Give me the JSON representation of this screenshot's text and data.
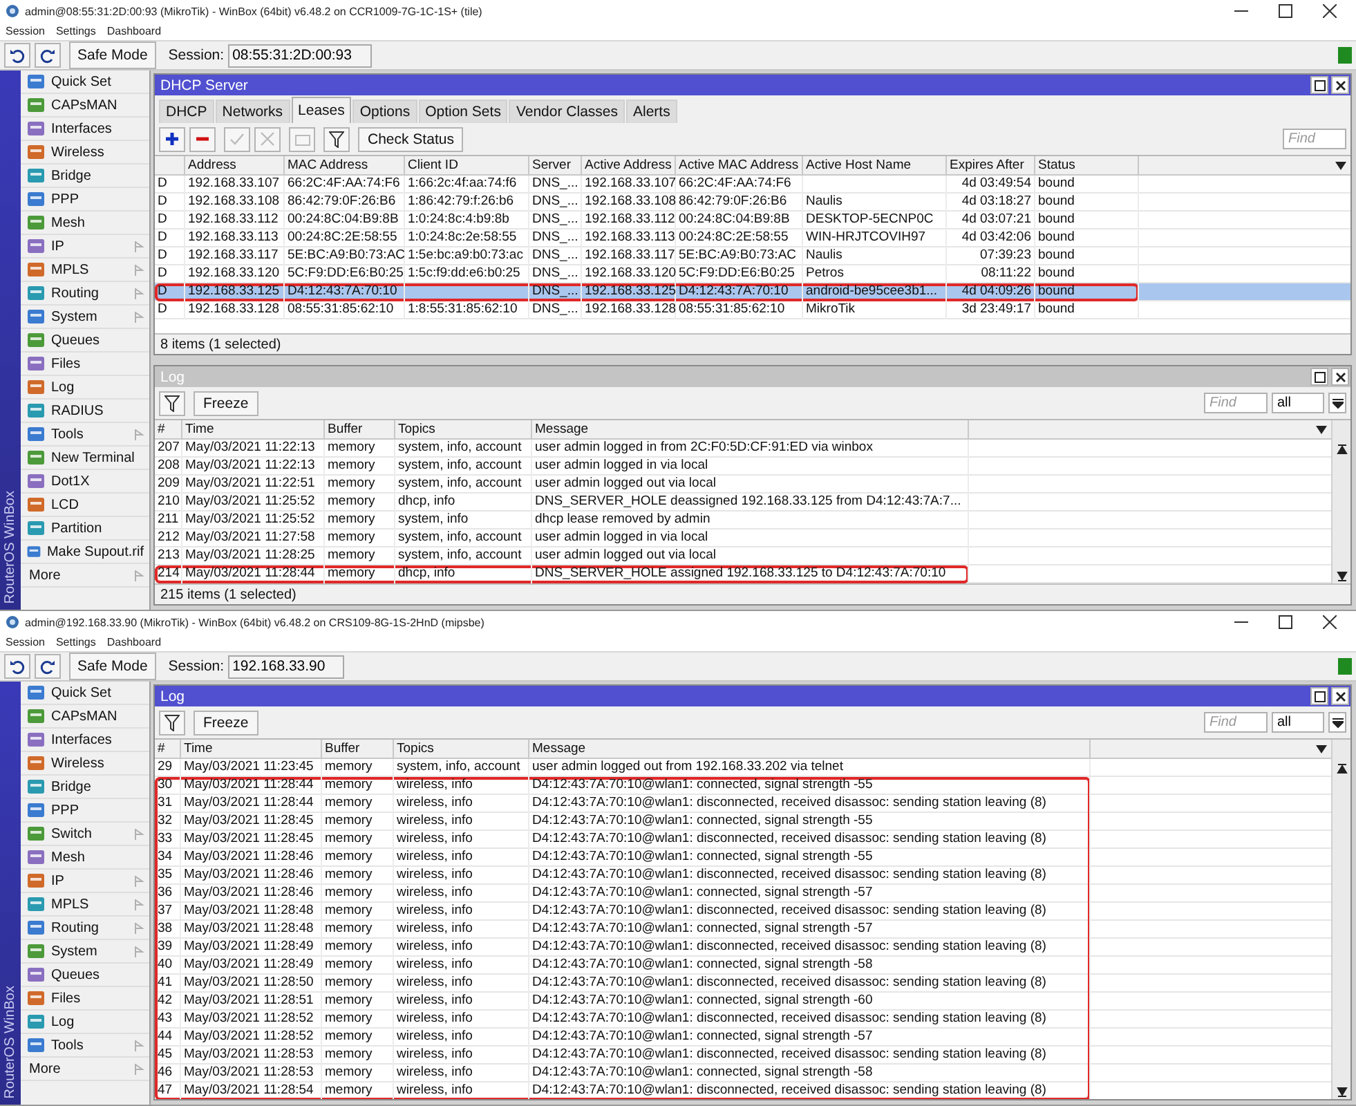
{
  "windows": [
    {
      "title": "admin@08:55:31:2D:00:93 (MikroTik) - WinBox (64bit) v6.48.2 on CCR1009-7G-1C-1S+ (tile)",
      "menu": [
        "Session",
        "Settings",
        "Dashboard"
      ],
      "safe_mode": "Safe Mode",
      "session_label": "Session:",
      "session_value": "08:55:31:2D:00:93",
      "brand": "RouterOS WinBox",
      "sidebar": [
        {
          "label": "Quick Set",
          "submenu": false
        },
        {
          "label": "CAPsMAN",
          "submenu": false
        },
        {
          "label": "Interfaces",
          "submenu": false
        },
        {
          "label": "Wireless",
          "submenu": false
        },
        {
          "label": "Bridge",
          "submenu": false
        },
        {
          "label": "PPP",
          "submenu": false
        },
        {
          "label": "Mesh",
          "submenu": false
        },
        {
          "label": "IP",
          "submenu": true
        },
        {
          "label": "MPLS",
          "submenu": true
        },
        {
          "label": "Routing",
          "submenu": true
        },
        {
          "label": "System",
          "submenu": true
        },
        {
          "label": "Queues",
          "submenu": false
        },
        {
          "label": "Files",
          "submenu": false
        },
        {
          "label": "Log",
          "submenu": false
        },
        {
          "label": "RADIUS",
          "submenu": false
        },
        {
          "label": "Tools",
          "submenu": true
        },
        {
          "label": "New Terminal",
          "submenu": false
        },
        {
          "label": "Dot1X",
          "submenu": false
        },
        {
          "label": "LCD",
          "submenu": false
        },
        {
          "label": "Partition",
          "submenu": false
        },
        {
          "label": "Make Supout.rif",
          "submenu": false
        },
        {
          "label": "More",
          "submenu": true,
          "kind": "more"
        }
      ],
      "panels": [
        {
          "kind": "dhcp",
          "title": "DHCP Server",
          "active": true,
          "tabs": [
            {
              "label": "DHCP",
              "selected": false
            },
            {
              "label": "Networks",
              "selected": false
            },
            {
              "label": "Leases",
              "selected": true
            },
            {
              "label": "Options",
              "selected": false
            },
            {
              "label": "Option Sets",
              "selected": false
            },
            {
              "label": "Vendor Classes",
              "selected": false
            },
            {
              "label": "Alerts",
              "selected": false
            }
          ],
          "button": "Check Status",
          "find_placeholder": "Find",
          "columns": [
            "",
            "Address",
            "MAC Address",
            "Client ID",
            "Server",
            "Active Address",
            "Active MAC Address",
            "Active Host Name",
            "Expires After",
            "Status"
          ],
          "rows": [
            {
              "cells": [
                "D",
                "192.168.33.107",
                "66:2C:4F:AA:74:F6",
                "1:66:2c:4f:aa:74:f6",
                "DNS_...",
                "192.168.33.107",
                "66:2C:4F:AA:74:F6",
                "",
                "4d 03:49:54",
                "bound"
              ],
              "selected": false,
              "highlighted": false
            },
            {
              "cells": [
                "D",
                "192.168.33.108",
                "86:42:79:0F:26:B6",
                "1:86:42:79:f:26:b6",
                "DNS_...",
                "192.168.33.108",
                "86:42:79:0F:26:B6",
                "Naulis",
                "4d 03:18:27",
                "bound"
              ],
              "selected": false,
              "highlighted": false
            },
            {
              "cells": [
                "D",
                "192.168.33.112",
                "00:24:8C:04:B9:8B",
                "1:0:24:8c:4:b9:8b",
                "DNS_...",
                "192.168.33.112",
                "00:24:8C:04:B9:8B",
                "DESKTOP-5ECNP0C",
                "4d 03:07:21",
                "bound"
              ],
              "selected": false,
              "highlighted": false
            },
            {
              "cells": [
                "D",
                "192.168.33.113",
                "00:24:8C:2E:58:55",
                "1:0:24:8c:2e:58:55",
                "DNS_...",
                "192.168.33.113",
                "00:24:8C:2E:58:55",
                "WIN-HRJTCOVIH97",
                "4d 03:42:06",
                "bound"
              ],
              "selected": false,
              "highlighted": false
            },
            {
              "cells": [
                "D",
                "192.168.33.117",
                "5E:BC:A9:B0:73:AC",
                "1:5e:bc:a9:b0:73:ac",
                "DNS_...",
                "192.168.33.117",
                "5E:BC:A9:B0:73:AC",
                "Naulis",
                "07:39:23",
                "bound"
              ],
              "selected": false,
              "highlighted": false
            },
            {
              "cells": [
                "D",
                "192.168.33.120",
                "5C:F9:DD:E6:B0:25",
                "1:5c:f9:dd:e6:b0:25",
                "DNS_...",
                "192.168.33.120",
                "5C:F9:DD:E6:B0:25",
                "Petros",
                "08:11:22",
                "bound"
              ],
              "selected": false,
              "highlighted": false
            },
            {
              "cells": [
                "D",
                "192.168.33.125",
                "D4:12:43:7A:70:10",
                "",
                "DNS_...",
                "192.168.33.125",
                "D4:12:43:7A:70:10",
                "android-be95cee3b1...",
                "4d 04:09:26",
                "bound"
              ],
              "selected": true,
              "highlighted": true
            },
            {
              "cells": [
                "D",
                "192.168.33.128",
                "08:55:31:85:62:10",
                "1:8:55:31:85:62:10",
                "DNS_...",
                "192.168.33.128",
                "08:55:31:85:62:10",
                "MikroTik",
                "3d 23:49:17",
                "bound"
              ],
              "selected": false,
              "highlighted": false
            }
          ],
          "footer": "8 items (1 selected)"
        },
        {
          "kind": "log",
          "title": "Log",
          "active": false,
          "button": "Freeze",
          "find_placeholder": "Find",
          "filter_value": "all",
          "columns": [
            "#",
            "Time",
            "Buffer",
            "Topics",
            "Message"
          ],
          "rows": [
            {
              "cells": [
                "207",
                "May/03/2021 11:22:13",
                "memory",
                "system, info, account",
                "user admin logged in from 2C:F0:5D:CF:91:ED via winbox"
              ],
              "selected": false,
              "highlighted": false
            },
            {
              "cells": [
                "208",
                "May/03/2021 11:22:13",
                "memory",
                "system, info, account",
                "user admin logged in via local"
              ],
              "selected": false,
              "highlighted": false
            },
            {
              "cells": [
                "209",
                "May/03/2021 11:22:51",
                "memory",
                "system, info, account",
                "user admin logged out via local"
              ],
              "selected": false,
              "highlighted": false
            },
            {
              "cells": [
                "210",
                "May/03/2021 11:25:52",
                "memory",
                "dhcp, info",
                "DNS_SERVER_HOLE deassigned 192.168.33.125 from D4:12:43:7A:7..."
              ],
              "selected": false,
              "highlighted": false
            },
            {
              "cells": [
                "211",
                "May/03/2021 11:25:52",
                "memory",
                "system, info",
                "dhcp lease removed by admin"
              ],
              "selected": false,
              "highlighted": false
            },
            {
              "cells": [
                "212",
                "May/03/2021 11:27:58",
                "memory",
                "system, info, account",
                "user admin logged in via local"
              ],
              "selected": false,
              "highlighted": false
            },
            {
              "cells": [
                "213",
                "May/03/2021 11:28:25",
                "memory",
                "system, info, account",
                "user admin logged out via local"
              ],
              "selected": false,
              "highlighted": false
            },
            {
              "cells": [
                "214",
                "May/03/2021 11:28:44",
                "memory",
                "dhcp, info",
                "DNS_SERVER_HOLE assigned 192.168.33.125 to D4:12:43:7A:70:10"
              ],
              "selected": false,
              "highlighted": true
            }
          ],
          "footer": "215 items (1 selected)"
        }
      ]
    },
    {
      "title": "admin@192.168.33.90 (MikroTik) - WinBox (64bit) v6.48.2 on CRS109-8G-1S-2HnD (mipsbe)",
      "menu": [
        "Session",
        "Settings",
        "Dashboard"
      ],
      "safe_mode": "Safe Mode",
      "session_label": "Session:",
      "session_value": "192.168.33.90",
      "brand": "RouterOS WinBox",
      "sidebar": [
        {
          "label": "Quick Set",
          "submenu": false
        },
        {
          "label": "CAPsMAN",
          "submenu": false
        },
        {
          "label": "Interfaces",
          "submenu": false
        },
        {
          "label": "Wireless",
          "submenu": false
        },
        {
          "label": "Bridge",
          "submenu": false
        },
        {
          "label": "PPP",
          "submenu": false
        },
        {
          "label": "Switch",
          "submenu": true
        },
        {
          "label": "Mesh",
          "submenu": false
        },
        {
          "label": "IP",
          "submenu": true
        },
        {
          "label": "MPLS",
          "submenu": true
        },
        {
          "label": "Routing",
          "submenu": true
        },
        {
          "label": "System",
          "submenu": true
        },
        {
          "label": "Queues",
          "submenu": false
        },
        {
          "label": "Files",
          "submenu": false
        },
        {
          "label": "Log",
          "submenu": false
        },
        {
          "label": "Tools",
          "submenu": true
        },
        {
          "label": "More",
          "submenu": true,
          "kind": "more"
        }
      ],
      "panels": [
        {
          "kind": "log",
          "title": "Log",
          "active": true,
          "button": "Freeze",
          "find_placeholder": "Find",
          "filter_value": "all",
          "columns": [
            "#",
            "Time",
            "Buffer",
            "Topics",
            "Message"
          ],
          "rows": [
            {
              "cells": [
                "29",
                "May/03/2021 11:23:45",
                "memory",
                "system, info, account",
                "user admin logged out from 192.168.33.202 via telnet"
              ],
              "selected": false,
              "highlighted": false
            },
            {
              "cells": [
                "30",
                "May/03/2021 11:28:44",
                "memory",
                "wireless, info",
                "D4:12:43:7A:70:10@wlan1: connected, signal strength -55"
              ],
              "selected": false,
              "highlighted": true
            },
            {
              "cells": [
                "31",
                "May/03/2021 11:28:44",
                "memory",
                "wireless, info",
                "D4:12:43:7A:70:10@wlan1: disconnected, received disassoc: sending station leaving (8)"
              ],
              "selected": false,
              "highlighted": true
            },
            {
              "cells": [
                "32",
                "May/03/2021 11:28:45",
                "memory",
                "wireless, info",
                "D4:12:43:7A:70:10@wlan1: connected, signal strength -55"
              ],
              "selected": false,
              "highlighted": true
            },
            {
              "cells": [
                "33",
                "May/03/2021 11:28:45",
                "memory",
                "wireless, info",
                "D4:12:43:7A:70:10@wlan1: disconnected, received disassoc: sending station leaving (8)"
              ],
              "selected": false,
              "highlighted": true
            },
            {
              "cells": [
                "34",
                "May/03/2021 11:28:46",
                "memory",
                "wireless, info",
                "D4:12:43:7A:70:10@wlan1: connected, signal strength -55"
              ],
              "selected": false,
              "highlighted": true
            },
            {
              "cells": [
                "35",
                "May/03/2021 11:28:46",
                "memory",
                "wireless, info",
                "D4:12:43:7A:70:10@wlan1: disconnected, received disassoc: sending station leaving (8)"
              ],
              "selected": false,
              "highlighted": true
            },
            {
              "cells": [
                "36",
                "May/03/2021 11:28:46",
                "memory",
                "wireless, info",
                "D4:12:43:7A:70:10@wlan1: connected, signal strength -57"
              ],
              "selected": false,
              "highlighted": true
            },
            {
              "cells": [
                "37",
                "May/03/2021 11:28:48",
                "memory",
                "wireless, info",
                "D4:12:43:7A:70:10@wlan1: disconnected, received disassoc: sending station leaving (8)"
              ],
              "selected": false,
              "highlighted": true
            },
            {
              "cells": [
                "38",
                "May/03/2021 11:28:48",
                "memory",
                "wireless, info",
                "D4:12:43:7A:70:10@wlan1: connected, signal strength -57"
              ],
              "selected": false,
              "highlighted": true
            },
            {
              "cells": [
                "39",
                "May/03/2021 11:28:49",
                "memory",
                "wireless, info",
                "D4:12:43:7A:70:10@wlan1: disconnected, received disassoc: sending station leaving (8)"
              ],
              "selected": false,
              "highlighted": true
            },
            {
              "cells": [
                "40",
                "May/03/2021 11:28:49",
                "memory",
                "wireless, info",
                "D4:12:43:7A:70:10@wlan1: connected, signal strength -58"
              ],
              "selected": false,
              "highlighted": true
            },
            {
              "cells": [
                "41",
                "May/03/2021 11:28:50",
                "memory",
                "wireless, info",
                "D4:12:43:7A:70:10@wlan1: disconnected, received disassoc: sending station leaving (8)"
              ],
              "selected": false,
              "highlighted": true
            },
            {
              "cells": [
                "42",
                "May/03/2021 11:28:51",
                "memory",
                "wireless, info",
                "D4:12:43:7A:70:10@wlan1: connected, signal strength -60"
              ],
              "selected": false,
              "highlighted": true
            },
            {
              "cells": [
                "43",
                "May/03/2021 11:28:52",
                "memory",
                "wireless, info",
                "D4:12:43:7A:70:10@wlan1: disconnected, received disassoc: sending station leaving (8)"
              ],
              "selected": false,
              "highlighted": true
            },
            {
              "cells": [
                "44",
                "May/03/2021 11:28:52",
                "memory",
                "wireless, info",
                "D4:12:43:7A:70:10@wlan1: connected, signal strength -57"
              ],
              "selected": false,
              "highlighted": true
            },
            {
              "cells": [
                "45",
                "May/03/2021 11:28:53",
                "memory",
                "wireless, info",
                "D4:12:43:7A:70:10@wlan1: disconnected, received disassoc: sending station leaving (8)"
              ],
              "selected": false,
              "highlighted": true
            },
            {
              "cells": [
                "46",
                "May/03/2021 11:28:53",
                "memory",
                "wireless, info",
                "D4:12:43:7A:70:10@wlan1: connected, signal strength -58"
              ],
              "selected": false,
              "highlighted": true
            },
            {
              "cells": [
                "47",
                "May/03/2021 11:28:54",
                "memory",
                "wireless, info",
                "D4:12:43:7A:70:10@wlan1: disconnected, received disassoc: sending station leaving (8)"
              ],
              "selected": false,
              "highlighted": true
            }
          ]
        }
      ]
    }
  ]
}
